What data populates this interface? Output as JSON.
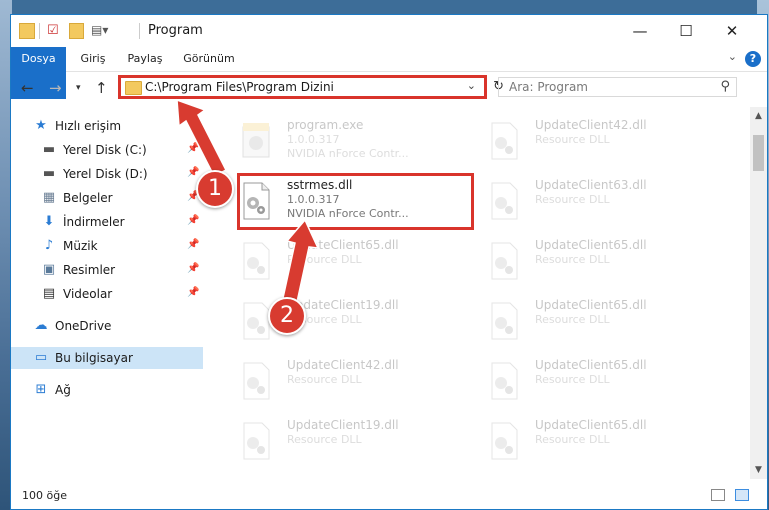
{
  "window": {
    "title": "Program",
    "controls": {
      "minimize": "—",
      "maximize": "☐",
      "close": "✕"
    }
  },
  "ribbon": {
    "tabs": [
      "Dosya",
      "Giriş",
      "Paylaş",
      "Görünüm"
    ],
    "help": "?"
  },
  "address": {
    "path": "C:\\Program Files\\Program Dizini",
    "search_placeholder": "Ara: Program"
  },
  "sidebar": {
    "items": [
      {
        "label": "Hızlı erişim",
        "icon": "star-icon"
      },
      {
        "label": "Yerel Disk (C:)",
        "icon": "drive-icon"
      },
      {
        "label": "Yerel Disk (D:)",
        "icon": "drive-icon"
      },
      {
        "label": "Belgeler",
        "icon": "documents-icon"
      },
      {
        "label": "İndirmeler",
        "icon": "download-icon"
      },
      {
        "label": "Müzik",
        "icon": "music-icon"
      },
      {
        "label": "Resimler",
        "icon": "pictures-icon"
      },
      {
        "label": "Videolar",
        "icon": "video-icon"
      },
      {
        "label": "OneDrive",
        "icon": "cloud-icon"
      },
      {
        "label": "Bu bilgisayar",
        "icon": "computer-icon"
      },
      {
        "label": "Ağ",
        "icon": "network-icon"
      }
    ]
  },
  "files": {
    "left": [
      {
        "name": "program.exe",
        "sub": "1.0.0.317",
        "sub2": "NVIDIA nForce Contr..."
      },
      {
        "name": "sstrmes.dll",
        "sub": "1.0.0.317",
        "sub2": "NVIDIA nForce Contr..."
      },
      {
        "name": "UpdateClient65.dll",
        "sub": "Resource DLL",
        "sub2": ""
      },
      {
        "name": "UpdateClient19.dll",
        "sub": "Resource DLL",
        "sub2": ""
      },
      {
        "name": "UpdateClient42.dll",
        "sub": "Resource DLL",
        "sub2": ""
      },
      {
        "name": "UpdateClient19.dll",
        "sub": "Resource DLL",
        "sub2": ""
      }
    ],
    "right": [
      {
        "name": "UpdateClient42.dll",
        "sub": "Resource DLL"
      },
      {
        "name": "UpdateClient63.dll",
        "sub": "Resource DLL"
      },
      {
        "name": "UpdateClient65.dll",
        "sub": "Resource DLL"
      },
      {
        "name": "UpdateClient65.dll",
        "sub": "Resource DLL"
      },
      {
        "name": "UpdateClient65.dll",
        "sub": "Resource DLL"
      },
      {
        "name": "UpdateClient65.dll",
        "sub": "Resource DLL"
      }
    ]
  },
  "status": {
    "count": "100 öğe"
  },
  "callouts": [
    "1",
    "2"
  ],
  "colors": {
    "accent": "#1a6fc9",
    "highlight": "#d9342b",
    "selected": "#cce4f7"
  }
}
